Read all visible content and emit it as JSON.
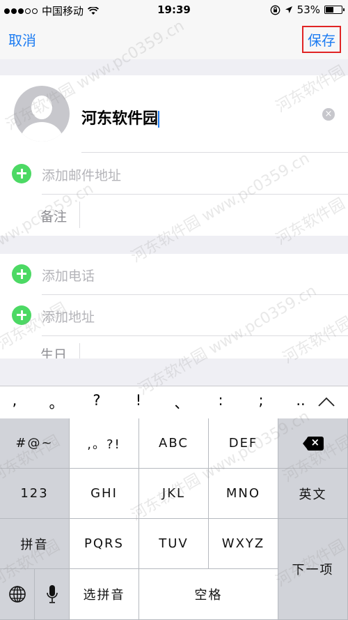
{
  "status_bar": {
    "carrier": "中国移动",
    "time": "19:39",
    "battery": "53%",
    "battery_level": 0.53
  },
  "nav": {
    "cancel": "取消",
    "save": "保存"
  },
  "contact": {
    "name": "河东软件园"
  },
  "fields": {
    "add_email": "添加邮件地址",
    "notes": "备注",
    "add_phone": "添加电话",
    "add_address": "添加地址",
    "birthday": "生日"
  },
  "punctuation": [
    ",",
    "。",
    "?",
    "!",
    "、",
    ":",
    ";",
    ".."
  ],
  "keyboard": {
    "symbols": "#@~",
    "punct": ",。?!",
    "abc": "ABC",
    "def": "DEF",
    "num": "123",
    "ghi": "GHI",
    "jkl": "JKL",
    "mno": "MNO",
    "english": "英文",
    "pinyin": "拼音",
    "pqrs": "PQRS",
    "tuv": "TUV",
    "wxyz": "WXYZ",
    "next": "下一项",
    "select_pinyin": "选拼音",
    "space": "空格"
  },
  "watermark": [
    "河东软件园",
    "www.pc0359.cn"
  ]
}
